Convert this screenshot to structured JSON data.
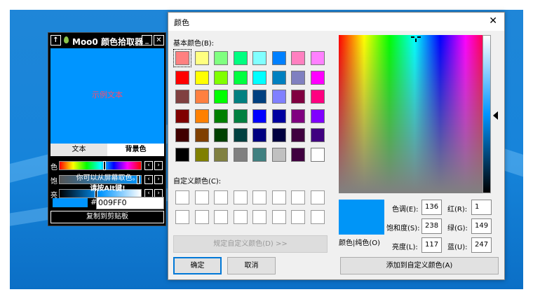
{
  "picker": {
    "title": "Moo0 颜色拾取器",
    "up_symbol": "↑",
    "minimize_symbol": "_",
    "close_symbol": "✕",
    "sample_text": "示例文本",
    "tabs": [
      "文本",
      "背景色"
    ],
    "active_tab": 1,
    "hue_label": "色",
    "saturation_label": "饱",
    "brightness_label": "亮",
    "prev_symbol": "‹",
    "next_symbol": "›",
    "hint_line1": "你可以从屏幕取色。",
    "hint_line2": "请按Alt键!",
    "hash_symbol": "#",
    "hex_value": "009FF0",
    "copy_label": "复制到剪贴板",
    "preview_color": "#0095ff"
  },
  "dialog": {
    "title": "颜色",
    "close_symbol": "✕",
    "basic_colors_label": "基本颜色(B):",
    "basic_colors": [
      "#ff8080",
      "#ffff80",
      "#80ff80",
      "#00ff80",
      "#80ffff",
      "#0080ff",
      "#ff80c0",
      "#ff80ff",
      "#ff0000",
      "#ffff00",
      "#80ff00",
      "#00ff40",
      "#00ffff",
      "#0080c0",
      "#8080c0",
      "#ff00ff",
      "#804040",
      "#ff8040",
      "#00ff00",
      "#008080",
      "#004080",
      "#8080ff",
      "#800040",
      "#ff0080",
      "#800000",
      "#ff8000",
      "#008000",
      "#008040",
      "#0000ff",
      "#0000a0",
      "#800080",
      "#8000ff",
      "#400000",
      "#804000",
      "#004000",
      "#004040",
      "#000080",
      "#000040",
      "#400040",
      "#400080",
      "#000000",
      "#808000",
      "#808040",
      "#808080",
      "#408080",
      "#c0c0c0",
      "#400040",
      "#ffffff"
    ],
    "custom_colors_label": "自定义颜色(C):",
    "define_custom_label": "规定自定义颜色(D) >>",
    "ok_label": "确定",
    "cancel_label": "取消",
    "add_custom_label": "添加到自定义颜色(A)",
    "color_solid_label": "颜色|纯色(O)",
    "current_color": "#0095f7",
    "hue_label": "色调(E):",
    "hue_value": "136",
    "sat_label": "饱和度(S):",
    "sat_value": "238",
    "lum_label": "亮度(L):",
    "lum_value": "117",
    "red_label": "红(R):",
    "red_value": "1",
    "green_label": "绿(G):",
    "green_value": "149",
    "blue_label": "蓝(U):",
    "blue_value": "247"
  }
}
